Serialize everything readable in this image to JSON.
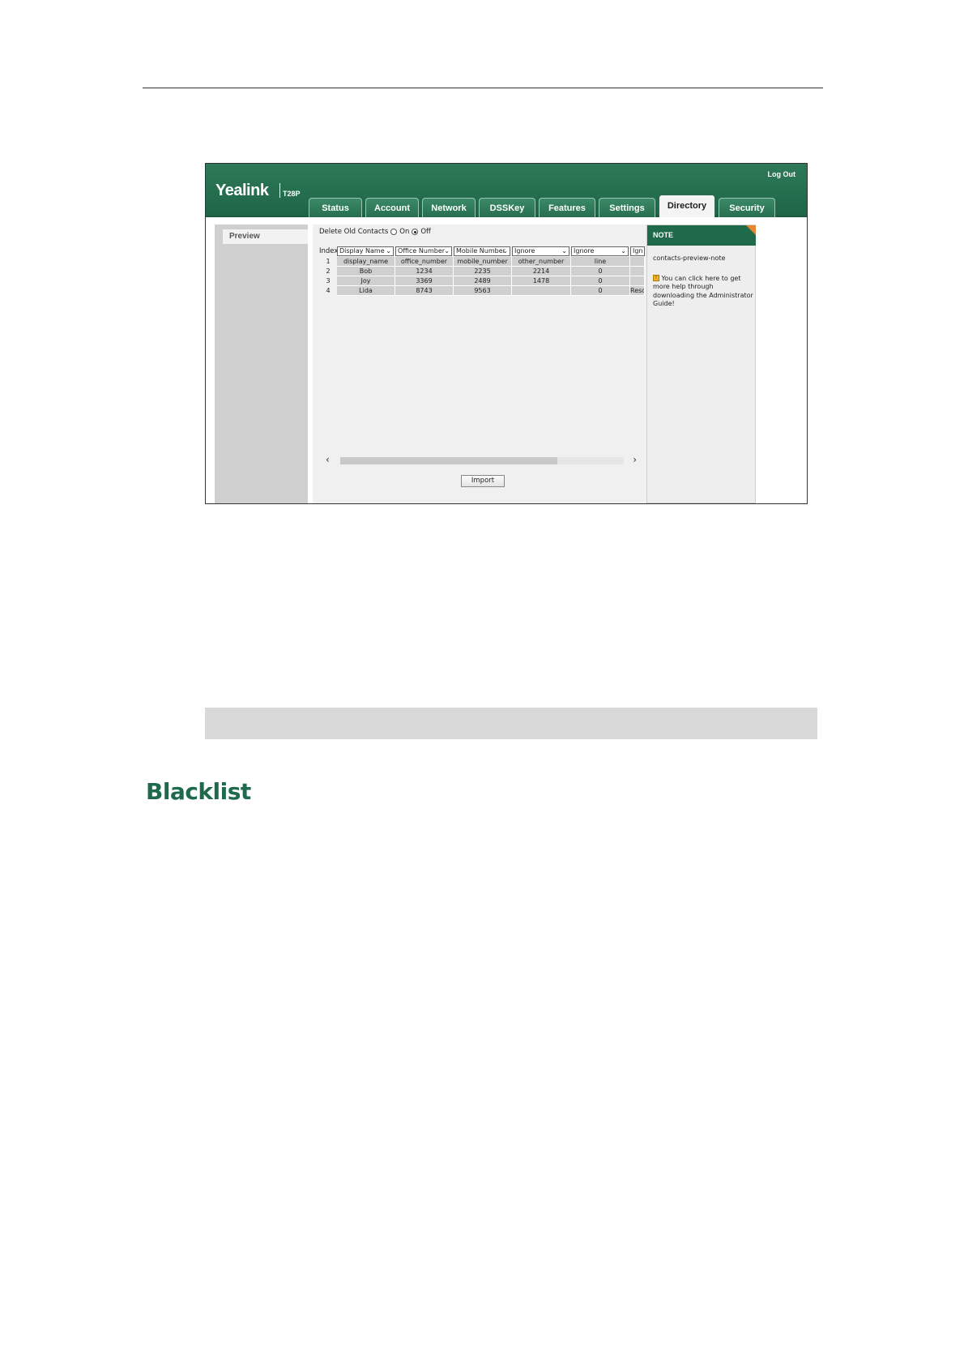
{
  "screenshot": {
    "brand": "Yealink",
    "model": "T28P",
    "logout": "Log Out",
    "tabs": [
      {
        "label": "Status",
        "active": false
      },
      {
        "label": "Account",
        "active": false
      },
      {
        "label": "Network",
        "active": false
      },
      {
        "label": "DSSKey",
        "active": false
      },
      {
        "label": "Features",
        "active": false
      },
      {
        "label": "Settings",
        "active": false
      },
      {
        "label": "Directory",
        "active": true
      },
      {
        "label": "Security",
        "active": false
      }
    ],
    "sidebar": {
      "items": [
        {
          "label": "Preview"
        }
      ]
    },
    "delete_old": {
      "label": "Delete Old Contacts",
      "on_label": "On",
      "off_label": "Off",
      "selected": "Off"
    },
    "mapping": {
      "index_label": "Index",
      "selects": [
        "Display Name",
        "Office Number",
        "Mobile Number",
        "Ignore",
        "Ignore",
        "Ign"
      ]
    },
    "rows": [
      {
        "index": "1",
        "cells": [
          "display_name",
          "office_number",
          "mobile_number",
          "other_number",
          "line",
          ""
        ]
      },
      {
        "index": "2",
        "cells": [
          "Bob",
          "1234",
          "2235",
          "2214",
          "0",
          ""
        ]
      },
      {
        "index": "3",
        "cells": [
          "Joy",
          "3369",
          "2489",
          "1478",
          "0",
          ""
        ]
      },
      {
        "index": "4",
        "cells": [
          "Lida",
          "8743",
          "9563",
          "",
          "0",
          "Reso"
        ]
      }
    ],
    "scroll": {
      "left_arrow": "‹",
      "right_arrow": "›"
    },
    "import_button": "Import",
    "note": {
      "title": "NOTE",
      "key": "contacts-preview-note",
      "help_icon": "!",
      "help_text": "You can click here to get more help through downloading the Administrator Guide!"
    }
  },
  "section": {
    "heading": "Blacklist"
  },
  "colors": {
    "brand_green": "#1f6a4b",
    "note_corner": "#e9852c"
  }
}
